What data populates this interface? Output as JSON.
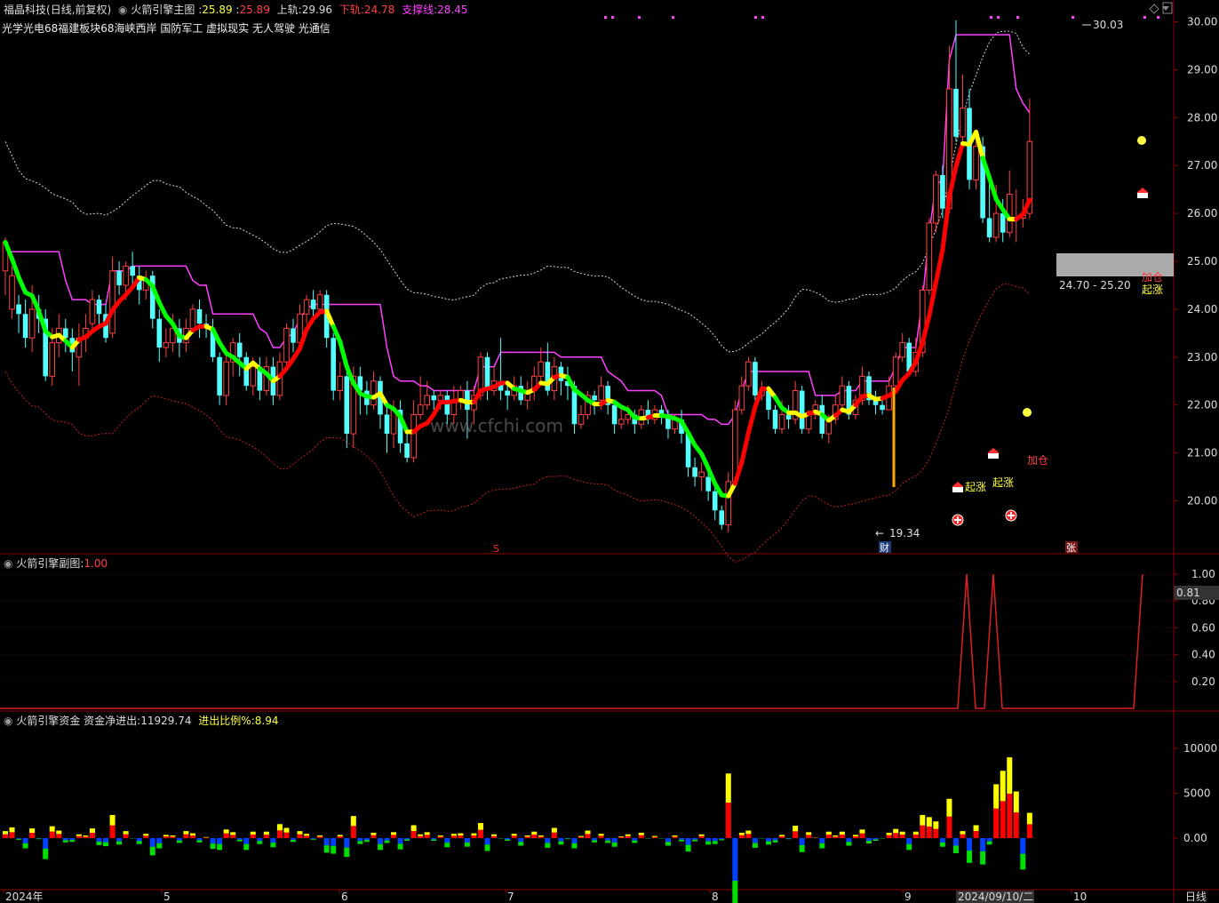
{
  "main_header": {
    "stock": "福晶科技",
    "mode": "(日线,前复权)",
    "indicator": "火箭引擎主图",
    "v1": "25.89",
    "v2": "25.89",
    "upper_label": "上轨:",
    "upper": "29.96",
    "lower_label": "下轨:",
    "lower": "24.78",
    "support_label": "支撑线:",
    "support": "28.45"
  },
  "concepts": "光学光电68福建板块68海峡西岸 国防军工 虚拟现实 无人驾驶 光通信",
  "sub1_header": {
    "name": "火箭引擎副图",
    "value": "1.00"
  },
  "sub2_header": {
    "name": "火箭引擎资金",
    "flow_label": "资金净进出:",
    "flow": "11929.74",
    "ratio_label": "进出比例%:",
    "ratio": "8.94"
  },
  "price_axis": [
    "30.00",
    "29.00",
    "28.00",
    "27.00",
    "26.00",
    "25.00",
    "24.00",
    "23.00",
    "22.00",
    "21.00",
    "20.00"
  ],
  "sub1_axis": [
    "1.00",
    "0.80",
    "0.60",
    "0.40",
    "0.20"
  ],
  "sub1_current": "0.81",
  "sub2_axis": [
    "10000",
    "5000",
    "0.00"
  ],
  "x_labels": [
    "2024年",
    "5",
    "6",
    "7",
    "8",
    "9",
    "10"
  ],
  "x_cursor_date": "2024/09/10/二",
  "period_label": "日线",
  "annotations": {
    "high": "30.03",
    "low": "19.34",
    "zone": "24.70 - 25.20",
    "jiacang1": "加仓",
    "qizhang1": "起涨",
    "jiacang2": "加仓",
    "qizhang2": "起涨",
    "qizhang3": "起涨",
    "cai": "财",
    "s_mark": "S",
    "zhang": "张",
    "watermark": "www.cfchi.com"
  },
  "colors": {
    "up_candle": "#ff4040",
    "down_candle": "#54ffff",
    "magenta": "#ff40ff",
    "green_line": "#00ff00",
    "red_line": "#ff0000",
    "yellow": "#ffff00",
    "blue_bar": "#0040ff"
  },
  "chart_data": {
    "type": "candlestick",
    "ylim": [
      19.2,
      30.3
    ],
    "candles": [
      [
        24.8,
        25.4,
        25.5,
        24.3
      ],
      [
        24.0,
        24.7,
        24.9,
        23.8
      ],
      [
        24.1,
        23.9,
        24.3,
        23.5
      ],
      [
        23.9,
        23.4,
        24.2,
        23.2
      ],
      [
        23.4,
        24.0,
        24.5,
        23.1
      ],
      [
        24.0,
        23.8,
        24.3,
        23.5
      ],
      [
        23.8,
        22.6,
        24.0,
        22.5
      ],
      [
        22.6,
        23.3,
        23.6,
        22.4
      ],
      [
        23.3,
        23.6,
        23.9,
        23.0
      ],
      [
        23.6,
        23.4,
        23.8,
        23.1
      ],
      [
        23.4,
        23.1,
        23.6,
        22.7
      ],
      [
        23.0,
        23.4,
        23.7,
        22.4
      ],
      [
        23.4,
        23.6,
        23.9,
        23.1
      ],
      [
        23.7,
        24.2,
        24.4,
        23.5
      ],
      [
        24.2,
        23.9,
        24.3,
        23.6
      ],
      [
        23.9,
        23.4,
        24.1,
        23.3
      ],
      [
        23.5,
        24.8,
        25.1,
        23.4
      ],
      [
        24.8,
        24.5,
        25.0,
        24.3
      ],
      [
        24.5,
        24.9,
        25.0,
        24.2
      ],
      [
        24.9,
        24.7,
        25.2,
        24.4
      ],
      [
        24.7,
        24.4,
        24.9,
        24.1
      ],
      [
        24.4,
        24.6,
        24.8,
        24.2
      ],
      [
        24.7,
        23.8,
        24.8,
        23.6
      ],
      [
        23.8,
        23.2,
        24.0,
        22.9
      ],
      [
        23.2,
        23.3,
        23.6,
        23.0
      ],
      [
        23.3,
        23.6,
        23.9,
        23.1
      ],
      [
        23.6,
        23.3,
        23.8,
        23.0
      ],
      [
        23.3,
        23.6,
        23.8,
        23.1
      ],
      [
        23.6,
        24.0,
        24.1,
        23.5
      ],
      [
        24.0,
        23.7,
        24.2,
        23.4
      ],
      [
        23.7,
        23.6,
        23.9,
        23.4
      ],
      [
        23.6,
        23.0,
        23.8,
        22.9
      ],
      [
        23.0,
        22.2,
        23.1,
        22.0
      ],
      [
        22.2,
        22.9,
        23.1,
        22.0
      ],
      [
        22.9,
        23.3,
        23.4,
        22.6
      ],
      [
        23.3,
        23.0,
        23.5,
        22.6
      ],
      [
        23.0,
        22.4,
        23.1,
        22.3
      ],
      [
        22.4,
        22.8,
        23.0,
        22.2
      ],
      [
        22.8,
        22.3,
        23.0,
        22.1
      ],
      [
        22.3,
        22.8,
        23.0,
        22.2
      ],
      [
        22.8,
        22.2,
        23.0,
        22.0
      ],
      [
        22.2,
        22.9,
        23.1,
        22.1
      ],
      [
        22.9,
        23.6,
        23.7,
        22.8
      ],
      [
        23.6,
        23.3,
        23.8,
        23.1
      ],
      [
        23.3,
        23.9,
        24.1,
        23.2
      ],
      [
        23.9,
        24.2,
        24.3,
        23.7
      ],
      [
        24.2,
        24.0,
        24.4,
        23.8
      ],
      [
        24.0,
        24.3,
        24.4,
        23.9
      ],
      [
        24.3,
        23.4,
        24.4,
        23.2
      ],
      [
        23.4,
        22.3,
        23.5,
        22.1
      ],
      [
        22.3,
        22.6,
        22.9,
        22.1
      ],
      [
        22.6,
        21.4,
        22.7,
        21.1
      ],
      [
        21.4,
        22.6,
        22.8,
        21.1
      ],
      [
        22.6,
        22.3,
        22.8,
        21.8
      ],
      [
        22.3,
        22.0,
        22.5,
        21.8
      ],
      [
        22.0,
        22.5,
        22.7,
        21.9
      ],
      [
        22.5,
        21.8,
        22.6,
        21.5
      ],
      [
        21.8,
        21.4,
        22.0,
        21.0
      ],
      [
        21.4,
        21.9,
        22.1,
        21.1
      ],
      [
        21.9,
        21.2,
        22.1,
        21.0
      ],
      [
        21.2,
        20.9,
        21.4,
        20.8
      ],
      [
        20.9,
        21.8,
        22.1,
        20.8
      ],
      [
        21.8,
        22.0,
        22.6,
        21.7
      ],
      [
        22.0,
        22.2,
        22.5,
        21.9
      ],
      [
        22.2,
        22.1,
        22.3,
        21.9
      ],
      [
        22.1,
        22.2,
        22.3,
        21.9
      ],
      [
        22.2,
        21.8,
        22.3,
        21.6
      ],
      [
        21.8,
        22.1,
        22.4,
        21.6
      ],
      [
        22.1,
        22.3,
        22.4,
        21.9
      ],
      [
        22.3,
        21.9,
        22.5,
        21.3
      ],
      [
        21.9,
        22.2,
        22.4,
        21.6
      ],
      [
        22.2,
        23.0,
        23.1,
        22.1
      ],
      [
        23.0,
        22.3,
        23.1,
        22.1
      ],
      [
        22.3,
        22.5,
        22.8,
        22.2
      ],
      [
        22.5,
        22.3,
        23.4,
        22.1
      ],
      [
        22.3,
        22.2,
        22.5,
        21.9
      ],
      [
        22.2,
        22.4,
        22.6,
        22.1
      ],
      [
        22.4,
        22.1,
        22.6,
        22.0
      ],
      [
        22.1,
        22.3,
        22.5,
        21.9
      ],
      [
        22.3,
        22.6,
        22.8,
        22.1
      ],
      [
        22.6,
        22.9,
        23.2,
        22.5
      ],
      [
        22.9,
        22.3,
        23.3,
        22.2
      ],
      [
        22.3,
        22.8,
        23.0,
        22.1
      ],
      [
        22.8,
        22.5,
        22.9,
        22.2
      ],
      [
        22.5,
        22.4,
        22.8,
        22.1
      ],
      [
        22.4,
        21.6,
        22.5,
        21.4
      ],
      [
        21.6,
        21.8,
        22.0,
        21.5
      ],
      [
        21.8,
        22.2,
        22.3,
        21.7
      ],
      [
        22.2,
        22.1,
        22.3,
        21.8
      ],
      [
        22.1,
        22.4,
        22.6,
        21.9
      ],
      [
        22.4,
        22.0,
        22.5,
        21.8
      ],
      [
        22.0,
        21.6,
        22.1,
        21.4
      ],
      [
        21.6,
        21.7,
        22.0,
        21.5
      ],
      [
        21.7,
        21.8,
        22.0,
        21.6
      ],
      [
        21.8,
        21.6,
        21.9,
        21.4
      ],
      [
        21.6,
        21.9,
        22.0,
        21.5
      ],
      [
        21.9,
        21.7,
        22.1,
        21.6
      ],
      [
        21.7,
        21.9,
        22.0,
        21.6
      ],
      [
        21.9,
        21.8,
        22.0,
        21.6
      ],
      [
        21.8,
        21.5,
        21.9,
        21.3
      ],
      [
        21.5,
        21.7,
        21.8,
        21.4
      ],
      [
        21.7,
        21.4,
        21.9,
        21.2
      ],
      [
        21.4,
        20.7,
        21.5,
        20.5
      ],
      [
        20.7,
        20.5,
        20.9,
        20.3
      ],
      [
        20.5,
        20.6,
        20.8,
        20.2
      ],
      [
        20.5,
        20.2,
        20.6,
        20.0
      ],
      [
        20.2,
        19.8,
        20.3,
        19.6
      ],
      [
        19.8,
        19.5,
        19.9,
        19.4
      ],
      [
        19.5,
        20.4,
        20.6,
        19.34
      ],
      [
        20.4,
        21.9,
        22.1,
        20.3
      ],
      [
        21.9,
        22.4,
        22.6,
        21.8
      ],
      [
        22.4,
        22.9,
        23.0,
        22.3
      ],
      [
        22.9,
        22.2,
        23.0,
        22.1
      ],
      [
        22.2,
        22.3,
        22.5,
        22.1
      ],
      [
        22.3,
        21.9,
        22.4,
        21.7
      ],
      [
        21.9,
        21.5,
        22.0,
        21.4
      ],
      [
        21.5,
        21.8,
        22.1,
        21.4
      ],
      [
        21.8,
        21.7,
        22.0,
        21.5
      ],
      [
        21.7,
        22.3,
        22.5,
        21.6
      ],
      [
        22.3,
        21.5,
        22.4,
        21.4
      ],
      [
        21.5,
        21.8,
        21.9,
        21.4
      ],
      [
        21.8,
        22.0,
        22.1,
        21.7
      ],
      [
        22.0,
        21.4,
        22.2,
        21.3
      ],
      [
        21.4,
        21.7,
        21.8,
        21.2
      ],
      [
        21.7,
        22.0,
        22.2,
        21.6
      ],
      [
        22.0,
        22.4,
        22.6,
        21.9
      ],
      [
        22.4,
        21.8,
        22.5,
        21.7
      ],
      [
        21.8,
        22.1,
        22.2,
        21.7
      ],
      [
        22.1,
        22.6,
        22.8,
        22.0
      ],
      [
        22.6,
        22.1,
        22.7,
        22.0
      ],
      [
        22.1,
        22.0,
        22.3,
        21.8
      ],
      [
        22.0,
        21.9,
        22.1,
        21.8
      ],
      [
        21.9,
        22.4,
        22.6,
        21.9
      ],
      [
        22.4,
        23.0,
        23.1,
        22.3
      ],
      [
        23.0,
        23.3,
        23.5,
        22.9
      ],
      [
        23.3,
        22.7,
        23.4,
        22.6
      ],
      [
        22.7,
        23.1,
        23.4,
        22.6
      ],
      [
        23.1,
        24.4,
        24.5,
        23.0
      ],
      [
        24.4,
        25.8,
        25.9,
        24.3
      ],
      [
        25.8,
        26.8,
        26.9,
        25.6
      ],
      [
        26.8,
        26.1,
        27.0,
        25.9
      ],
      [
        26.1,
        28.6,
        29.5,
        26.0
      ],
      [
        28.6,
        27.6,
        30.03,
        27.5
      ],
      [
        27.6,
        28.2,
        28.9,
        27.4
      ],
      [
        28.2,
        26.7,
        28.6,
        26.5
      ],
      [
        26.7,
        27.4,
        27.6,
        26.5
      ],
      [
        27.4,
        25.9,
        27.6,
        25.8
      ],
      [
        25.9,
        25.5,
        26.8,
        25.4
      ],
      [
        25.5,
        26.0,
        26.6,
        25.4
      ],
      [
        26.0,
        25.6,
        26.3,
        25.4
      ],
      [
        25.6,
        26.4,
        26.9,
        25.5
      ],
      [
        25.9,
        25.9,
        26.5,
        25.4
      ],
      [
        25.9,
        26.0,
        26.3,
        25.7
      ],
      [
        26.0,
        27.5,
        28.4,
        25.9
      ]
    ]
  }
}
